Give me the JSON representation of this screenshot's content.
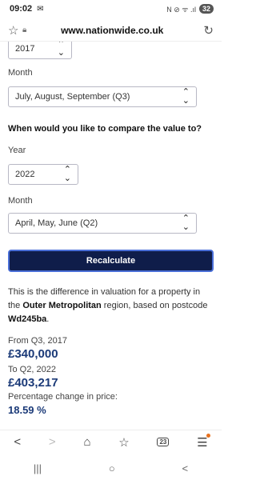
{
  "status_bar": {
    "time": "09:02",
    "mail_icon": "mail-icon",
    "signal_text": "N ⊘ ᯤ .ıl",
    "battery": "32"
  },
  "browser": {
    "url": "www.nationwide.co.uk"
  },
  "form": {
    "top_year_value": "2017",
    "month_label_1": "Month",
    "month_value_1": "July, August, September (Q3)",
    "compare_heading": "When would you like to compare the value to?",
    "year_label": "Year",
    "year_value": "2022",
    "month_label_2": "Month",
    "month_value_2": "April, May, June (Q2)",
    "recalculate_label": "Recalculate"
  },
  "result": {
    "intro_1": "This is the difference in valuation for a property in the ",
    "region": "Outer Metropolitan",
    "intro_2": " region, based on postcode ",
    "postcode": "Wd245ba",
    "intro_3": ".",
    "from_label": "From Q3, 2017",
    "from_value": "£340,000",
    "to_label": "To Q2, 2022",
    "to_value": "£403,217",
    "pct_label": "Percentage change in price:",
    "pct_value": "18.59 %"
  },
  "toolbar": {
    "tab_count": "23"
  },
  "colors": {
    "button_bg": "#0f1d4a",
    "accent": "#1b3a78",
    "menu_dot": "#e8711e"
  }
}
